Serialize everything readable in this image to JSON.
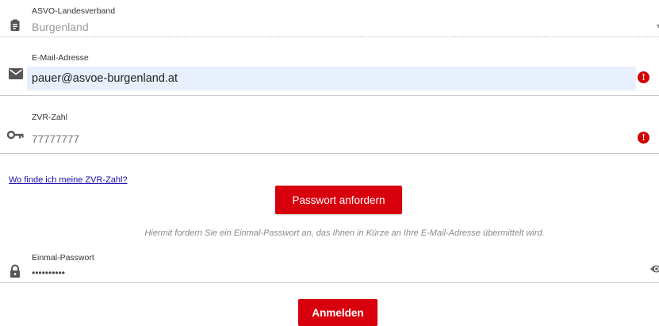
{
  "fields": {
    "verband": {
      "label": "ASVO-Landesverband",
      "value": "Burgenland",
      "icon": "clipboard-icon"
    },
    "email": {
      "label": "E-Mail-Adresse",
      "value": "pauer@asvoe-burgenland.at",
      "icon": "mail-icon",
      "error_icon": "!"
    },
    "zvr": {
      "label": "ZVR-Zahl",
      "value": "77777777",
      "icon": "key-icon",
      "error_icon": "!"
    },
    "otp": {
      "label": "Einmal-Passwort",
      "value": "••••••••••",
      "icon": "lock-icon"
    }
  },
  "links": {
    "zvr_help": "Wo finde ich meine ZVR-Zahl?"
  },
  "buttons": {
    "request_password": "Passwort anfordern",
    "login": "Anmelden"
  },
  "hint": "Hiermit fordern Sie ein Einmal-Passwort an, das Ihnen in Kürze an Ihre E-Mail-Adresse übermittelt wird.",
  "colors": {
    "accent": "#d8000c",
    "error": "#d10000",
    "link": "#1a0dab",
    "autofill": "#e8f0fe"
  }
}
